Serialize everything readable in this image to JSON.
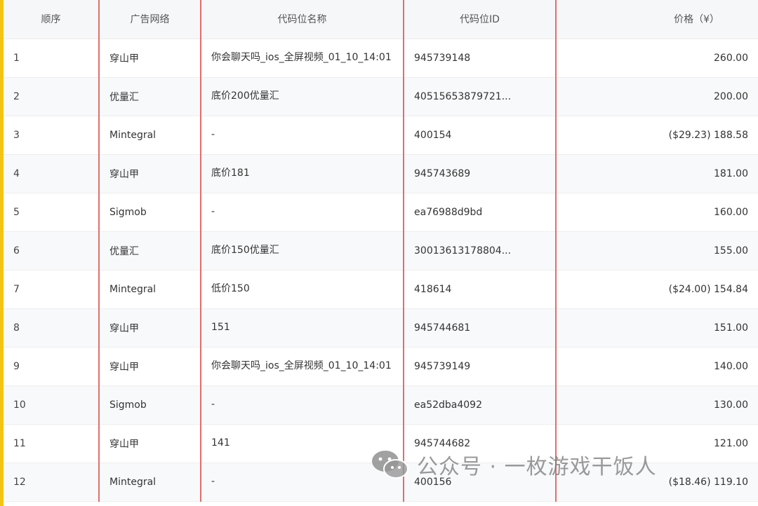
{
  "table": {
    "headers": {
      "seq": "顺序",
      "network": "广告网络",
      "name": "代码位名称",
      "id": "代码位ID",
      "price": "价格（¥）"
    },
    "rows": [
      {
        "seq": "1",
        "network": "穿山甲",
        "name": "你会聊天吗_ios_全屏视频_01_10_14:01",
        "id": "945739148",
        "price": "260.00"
      },
      {
        "seq": "2",
        "network": "优量汇",
        "name": "底价200优量汇",
        "id": "40515653879721...",
        "price": "200.00"
      },
      {
        "seq": "3",
        "network": "Mintegral",
        "name": "-",
        "id": "400154",
        "price": "($29.23) 188.58"
      },
      {
        "seq": "4",
        "network": "穿山甲",
        "name": "底价181",
        "id": "945743689",
        "price": "181.00"
      },
      {
        "seq": "5",
        "network": "Sigmob",
        "name": "-",
        "id": "ea76988d9bd",
        "price": "160.00"
      },
      {
        "seq": "6",
        "network": "优量汇",
        "name": "底价150优量汇",
        "id": "30013613178804...",
        "price": "155.00"
      },
      {
        "seq": "7",
        "network": "Mintegral",
        "name": "低价150",
        "id": "418614",
        "price": "($24.00) 154.84"
      },
      {
        "seq": "8",
        "network": "穿山甲",
        "name": "151",
        "id": "945744681",
        "price": "151.00"
      },
      {
        "seq": "9",
        "network": "穿山甲",
        "name": "你会聊天吗_ios_全屏视频_01_10_14:01",
        "id": "945739149",
        "price": "140.00"
      },
      {
        "seq": "10",
        "network": "Sigmob",
        "name": "-",
        "id": "ea52dba4092",
        "price": "130.00"
      },
      {
        "seq": "11",
        "network": "穿山甲",
        "name": "141",
        "id": "945744682",
        "price": "121.00"
      },
      {
        "seq": "12",
        "network": "Mintegral",
        "name": "-",
        "id": "400156",
        "price": "($18.46) 119.10"
      }
    ]
  },
  "watermark": {
    "text": "公众号 · 一枚游戏干饭人",
    "icon": "wechat-icon"
  },
  "colors": {
    "accent": "#f2c414",
    "highlight_border": "#e26d6d"
  }
}
